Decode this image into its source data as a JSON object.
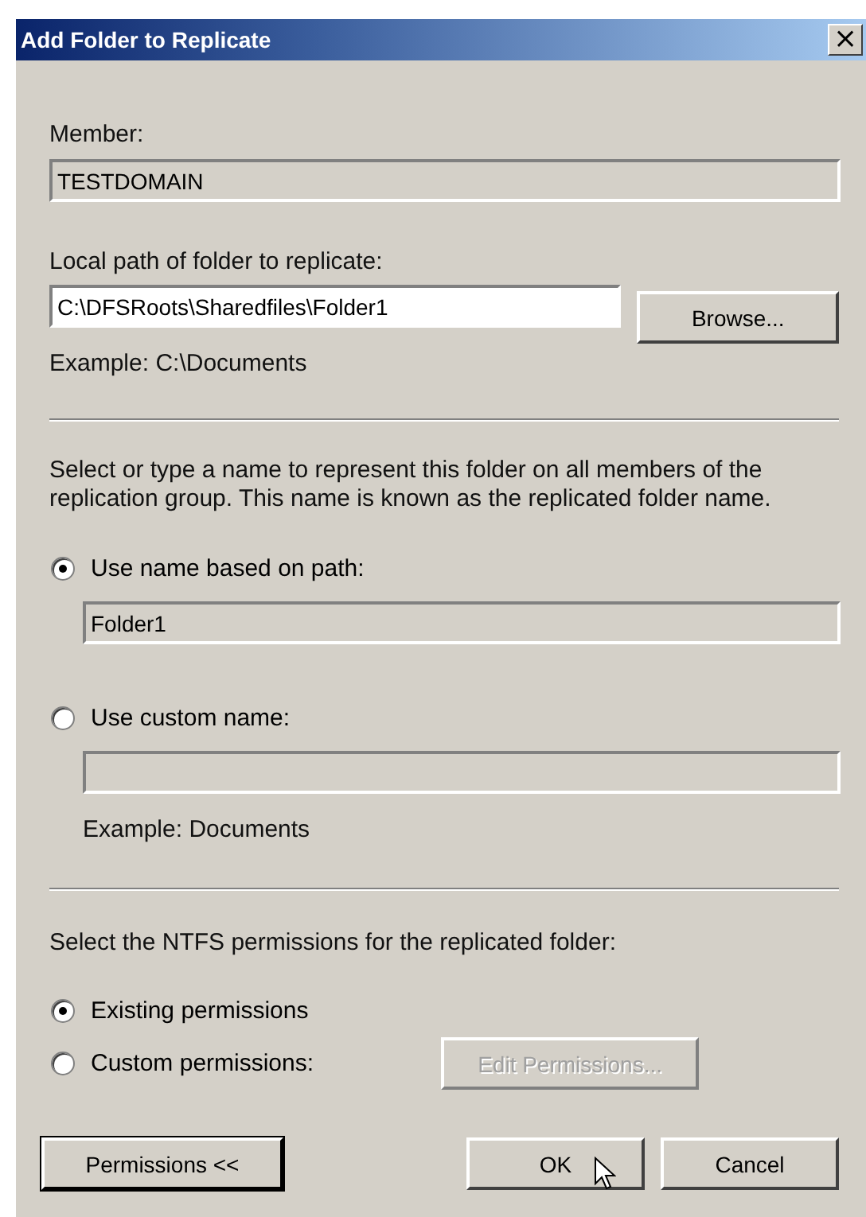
{
  "window": {
    "title": "Add Folder to Replicate",
    "close_button": "×"
  },
  "member": {
    "label": "Member:",
    "value": "TESTDOMAIN",
    "disabled": true
  },
  "local_path": {
    "label": "Local path of folder to replicate:",
    "value": "C:\\DFSRoots\\Sharedfiles\\Folder1",
    "disabled": false,
    "browse_button": "Browse...",
    "example": "Example: C:\\Documents"
  },
  "folder_name": {
    "description": "Select or type a name to represent this folder on all members of the replication group. This name is known as the replicated folder name.",
    "options": [
      {
        "label": "Use name based on path:",
        "selected": true,
        "field": {
          "value": "Folder1",
          "disabled": true
        }
      },
      {
        "label": "Use custom name:",
        "selected": false,
        "field": {
          "disabled": true
        },
        "example": "Example: Documents"
      }
    ]
  },
  "permissions": {
    "description": "Select the NTFS permissions for the replicated folder:",
    "options": [
      {
        "label": "Existing permissions",
        "selected": true
      },
      {
        "label": "Custom permissions:",
        "selected": false,
        "button": {
          "label": "Edit Permissions...",
          "disabled": true
        }
      }
    ]
  },
  "buttons": [
    {
      "label": "Permissions <<",
      "kind": "left",
      "focused": true
    },
    {
      "label": "OK",
      "kind": "right",
      "focused": false
    },
    {
      "label": "Cancel",
      "kind": "right",
      "focused": false
    }
  ]
}
